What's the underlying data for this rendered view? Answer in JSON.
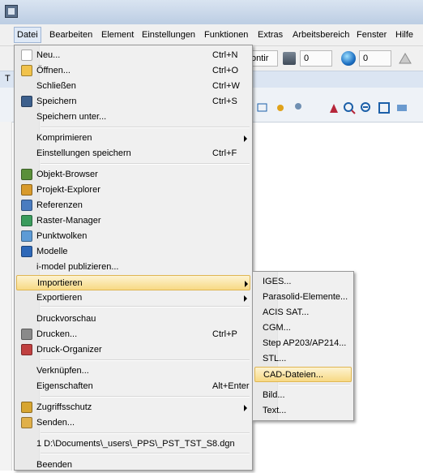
{
  "menubar": {
    "items": [
      {
        "id": "datei",
        "label": "Datei"
      },
      {
        "id": "bearbeiten",
        "label": "Bearbeiten"
      },
      {
        "id": "element",
        "label": "Element"
      },
      {
        "id": "einstellungen",
        "label": "Einstellungen"
      },
      {
        "id": "funktionen",
        "label": "Funktionen"
      },
      {
        "id": "extras",
        "label": "Extras"
      },
      {
        "id": "arbeitsbereich",
        "label": "Arbeitsbereich"
      },
      {
        "id": "fenster",
        "label": "Fenster"
      },
      {
        "id": "hilfe",
        "label": "Hilfe"
      }
    ]
  },
  "toolbar": {
    "combo_text": "ontir",
    "level_value": "0",
    "color_value": "0",
    "left_fragment": "T",
    "icons": [
      "layers-icon",
      "view-globe-icon",
      "triangle-icon",
      "fence-icon",
      "star-snap-icon",
      "person-icon",
      "zoom-in-icon",
      "zoom-out-icon",
      "fit-view-icon",
      "pan-icon"
    ]
  },
  "file_menu": {
    "items": [
      {
        "label": "Neu...",
        "shortcut": "Ctrl+N",
        "icon": "new-file-icon"
      },
      {
        "label": "Öffnen...",
        "shortcut": "Ctrl+O",
        "icon": "open-folder-icon"
      },
      {
        "label": "Schließen",
        "shortcut": "Ctrl+W",
        "icon": ""
      },
      {
        "label": "Speichern",
        "shortcut": "Ctrl+S",
        "icon": "save-disk-icon"
      },
      {
        "label": "Speichern unter...",
        "shortcut": "",
        "icon": ""
      },
      {
        "label": "Komprimieren",
        "shortcut": "",
        "icon": "",
        "submenu": true
      },
      {
        "label": "Einstellungen speichern",
        "shortcut": "Ctrl+F",
        "icon": ""
      },
      {
        "label": "Objekt-Browser",
        "shortcut": "",
        "icon": "object-browser-icon"
      },
      {
        "label": "Projekt-Explorer",
        "shortcut": "",
        "icon": "project-explorer-icon"
      },
      {
        "label": "Referenzen",
        "shortcut": "",
        "icon": "references-icon"
      },
      {
        "label": "Raster-Manager",
        "shortcut": "",
        "icon": "raster-manager-icon"
      },
      {
        "label": "Punktwolken",
        "shortcut": "",
        "icon": "point-cloud-icon"
      },
      {
        "label": "Modelle",
        "shortcut": "",
        "icon": "models-icon"
      },
      {
        "label": "i-model publizieren...",
        "shortcut": "",
        "icon": ""
      },
      {
        "label": "Importieren",
        "shortcut": "",
        "icon": "",
        "submenu": true,
        "highlight": true
      },
      {
        "label": "Exportieren",
        "shortcut": "",
        "icon": "",
        "submenu": true
      },
      {
        "label": "Druckvorschau",
        "shortcut": "",
        "icon": ""
      },
      {
        "label": "Drucken...",
        "shortcut": "Ctrl+P",
        "icon": "printer-icon"
      },
      {
        "label": "Druck-Organizer",
        "shortcut": "",
        "icon": "print-organizer-icon"
      },
      {
        "label": "Verknüpfen...",
        "shortcut": "",
        "icon": ""
      },
      {
        "label": "Eigenschaften",
        "shortcut": "Alt+Enter",
        "icon": ""
      },
      {
        "label": "Zugriffsschutz",
        "shortcut": "",
        "icon": "lock-icon",
        "submenu": true
      },
      {
        "label": "Senden...",
        "shortcut": "",
        "icon": "send-icon"
      },
      {
        "label": "1 D:\\Documents\\_users\\_PPS\\_PST_TST_S8.dgn",
        "shortcut": "",
        "icon": ""
      },
      {
        "label": "Beenden",
        "shortcut": "",
        "icon": ""
      }
    ]
  },
  "import_submenu": {
    "items": [
      {
        "label": "IGES..."
      },
      {
        "label": "Parasolid-Elemente..."
      },
      {
        "label": "ACIS SAT..."
      },
      {
        "label": "CGM..."
      },
      {
        "label": "Step AP203/AP214..."
      },
      {
        "label": "STL..."
      },
      {
        "label": "CAD-Dateien...",
        "highlight": true
      },
      {
        "label": "Bild..."
      },
      {
        "label": "Text..."
      }
    ]
  }
}
